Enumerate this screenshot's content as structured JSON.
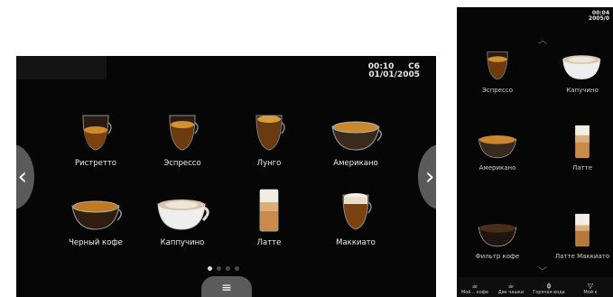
{
  "main": {
    "time": "00:10",
    "status_code": "C6",
    "date": "01/01/2005",
    "arrow_left": "‹",
    "arrow_right": "›",
    "menu_icon": "≡",
    "drinks": [
      {
        "label": "Ристретто",
        "icon": "espresso-glass"
      },
      {
        "label": "Эспрессо",
        "icon": "espresso-glass"
      },
      {
        "label": "Лунго",
        "icon": "espresso-glass"
      },
      {
        "label": "Американо",
        "icon": "wide-cup"
      },
      {
        "label": "Черный кофе",
        "icon": "wide-cup"
      },
      {
        "label": "Каппучино",
        "icon": "cappuccino-cup"
      },
      {
        "label": "Латте",
        "icon": "latte-glass"
      },
      {
        "label": "Маккиато",
        "icon": "macchiato-glass"
      }
    ],
    "pagination": {
      "pages": 4,
      "active": 1
    }
  },
  "side": {
    "time": "00:04",
    "date": "2005/0",
    "scroll_up": "︿",
    "scroll_down": "﹀",
    "drinks": [
      {
        "label": "Эспрессо",
        "icon": "espresso-glass"
      },
      {
        "label": "Капучино",
        "icon": "cappuccino-cup"
      },
      {
        "label": "Американо",
        "icon": "wide-cup"
      },
      {
        "label": "Латте",
        "icon": "latte-glass"
      },
      {
        "label": "Фильтр кофе",
        "icon": "filter-cup"
      },
      {
        "label": "Латте Маккиато",
        "icon": "latte-glass"
      }
    ],
    "bottom_items": [
      {
        "label": "Моё... кофе",
        "icon": "cup-icon"
      },
      {
        "label": "Две чашки",
        "icon": "two-cups-icon"
      },
      {
        "label": "Горячая вода",
        "icon": "water-icon"
      },
      {
        "label": "Мой к",
        "icon": "my-coffee-icon"
      }
    ]
  }
}
